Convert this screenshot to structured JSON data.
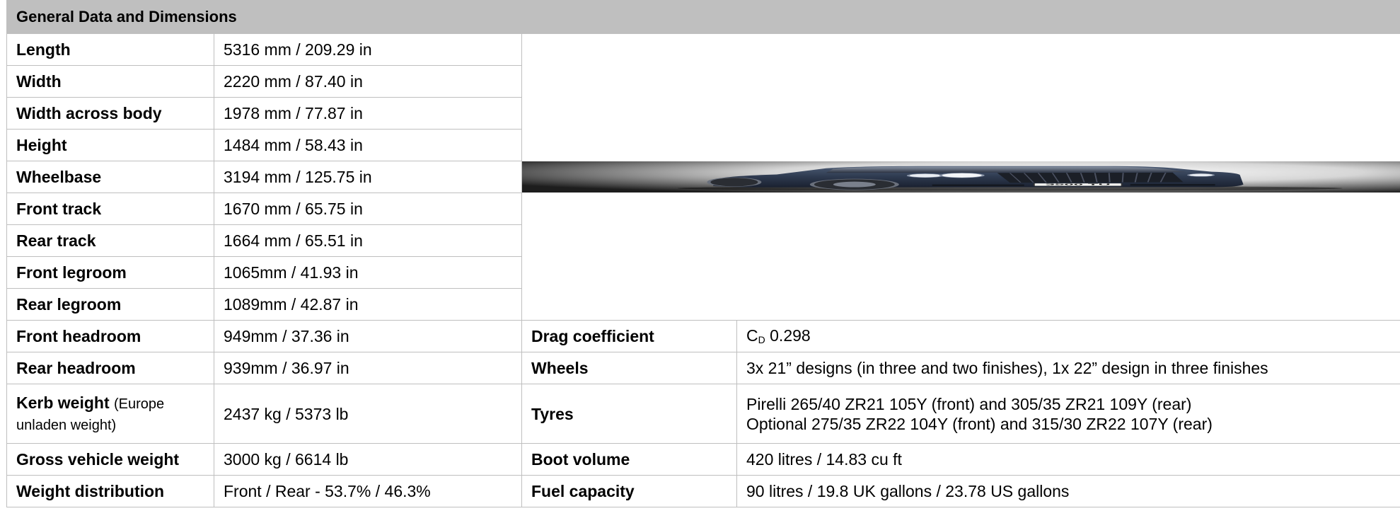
{
  "header": {
    "title": "General Data and Dimensions"
  },
  "dimensions": [
    {
      "label": "Length",
      "value": "5316 mm / 209.29 in"
    },
    {
      "label": "Width",
      "value": "2220 mm / 87.40 in"
    },
    {
      "label": "Width across body",
      "value": "1978 mm / 77.87 in"
    },
    {
      "label": "Height",
      "value": "1484 mm / 58.43 in"
    },
    {
      "label": "Wheelbase",
      "value": "3194 mm / 125.75 in"
    },
    {
      "label": "Front track",
      "value": "1670 mm / 65.75 in"
    },
    {
      "label": "Rear track",
      "value": "1664 mm / 65.51 in"
    },
    {
      "label": "Front legroom",
      "value": "1065mm / 41.93 in"
    },
    {
      "label": "Rear legroom",
      "value": "1089mm / 42.87 in"
    }
  ],
  "left_lower": [
    {
      "label": "Front headroom",
      "value": "949mm / 37.36 in"
    },
    {
      "label": "Rear headroom",
      "value": "939mm / 36.97 in"
    },
    {
      "label": "Kerb weight",
      "label_note": "(Europe unladen weight)",
      "value": "2437 kg / 5373 lb"
    },
    {
      "label": "Gross vehicle weight",
      "value": "3000 kg / 6614 lb"
    },
    {
      "label": "Weight distribution",
      "value": "Front / Rear - 53.7% / 46.3%"
    }
  ],
  "right_lower": [
    {
      "label": "Drag coefficient",
      "value_prefix": "C",
      "value_sub": "D",
      "value": " 0.298"
    },
    {
      "label": "Wheels",
      "value": "3x 21” designs (in three and two finishes), 1x 22” design in three finishes"
    },
    {
      "label": "Tyres",
      "value_line1": "Pirelli 265/40 ZR21 105Y (front) and 305/35 ZR21 109Y (rear)",
      "value_line2": "Optional 275/35 ZR22 104Y (front) and 315/30 ZR22 107Y (rear)"
    },
    {
      "label": "Boot volume",
      "value": "420 litres / 14.83 cu ft"
    },
    {
      "label": "Fuel capacity",
      "value": "90 litres / 19.8 UK gallons / 23.78 US gallons"
    }
  ],
  "image": {
    "plate": "3500 TU",
    "car_color": "#2e3a4f"
  }
}
